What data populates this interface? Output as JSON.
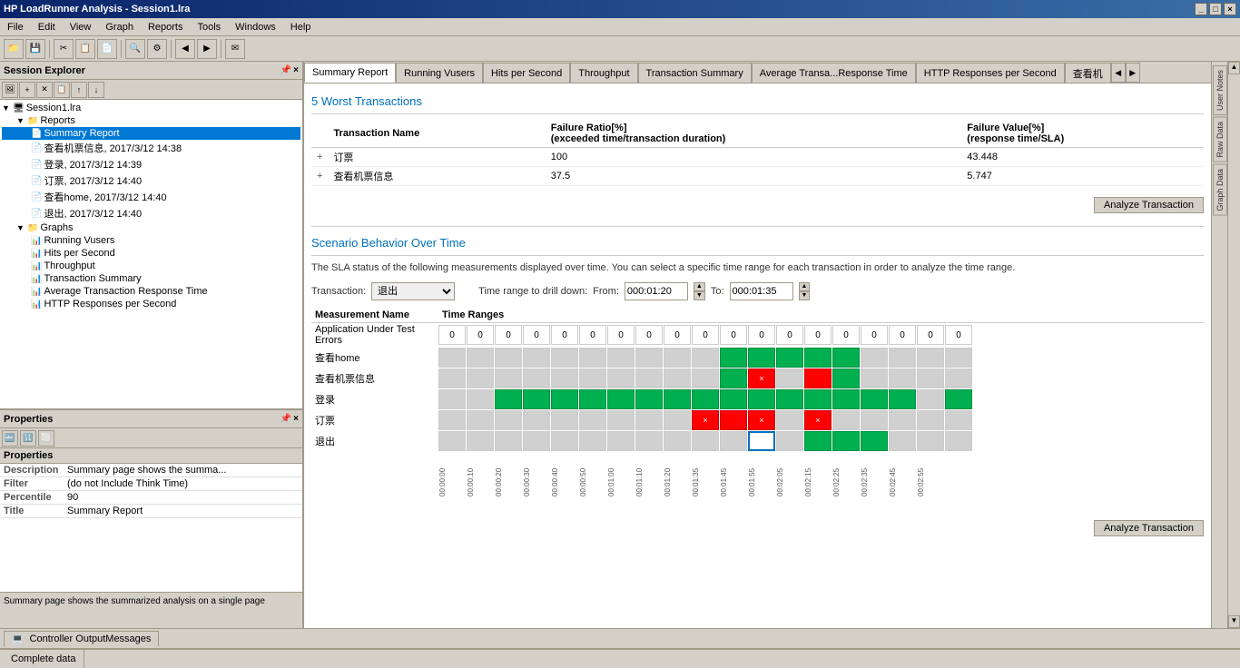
{
  "titleBar": {
    "title": "HP LoadRunner Analysis - Session1.lra",
    "buttons": [
      "_",
      "□",
      "×"
    ]
  },
  "menuBar": {
    "items": [
      "File",
      "Edit",
      "View",
      "Graph",
      "Reports",
      "Tools",
      "Windows",
      "Help"
    ]
  },
  "sessionExplorer": {
    "title": "Session Explorer",
    "tree": {
      "root": "Session1.lra",
      "reports": {
        "label": "Reports",
        "children": [
          {
            "label": "Summary Report",
            "selected": true
          },
          {
            "label": "查看机票信息, 2017/3/12 14:38"
          },
          {
            "label": "登录, 2017/3/12 14:39"
          },
          {
            "label": "订票, 2017/3/12 14:40"
          },
          {
            "label": "查看home, 2017/3/12 14:40"
          },
          {
            "label": "退出, 2017/3/12 14:40"
          }
        ]
      },
      "graphs": {
        "label": "Graphs",
        "children": [
          {
            "label": "Running Vusers"
          },
          {
            "label": "Hits per Second"
          },
          {
            "label": "Throughput"
          },
          {
            "label": "Transaction Summary"
          },
          {
            "label": "Average Transaction Response Time"
          },
          {
            "label": "HTTP Responses per Second"
          }
        ]
      }
    }
  },
  "properties": {
    "title": "Properties",
    "rows": [
      {
        "key": "Description",
        "value": "Summary page shows the summa..."
      },
      {
        "key": "Filter",
        "value": "(do not Include Think Time)"
      },
      {
        "key": "Percentile",
        "value": "90"
      },
      {
        "key": "Title",
        "value": "Summary Report"
      }
    ]
  },
  "statusBarLeft": "Summary page shows the summarized analysis on a single page",
  "tabs": [
    {
      "label": "Summary Report",
      "active": true
    },
    {
      "label": "Running Vusers"
    },
    {
      "label": "Hits per Second"
    },
    {
      "label": "Throughput"
    },
    {
      "label": "Transaction Summary"
    },
    {
      "label": "Average Transa...Response Time"
    },
    {
      "label": "HTTP Responses per Second"
    },
    {
      "label": "查看机"
    }
  ],
  "rightSidebar": {
    "items": [
      "User Notes",
      "Raw Data",
      "Graph Data"
    ]
  },
  "mainContent": {
    "worstTransactions": {
      "title": "5 Worst Transactions",
      "tableHeaders": [
        "Transaction Name",
        "Failure Ratio[%]\n(exceeded time/transaction duration)",
        "Failure Value[%]\n(response time/SLA)"
      ],
      "rows": [
        {
          "expand": "+",
          "name": "订票",
          "failureRatio": "100",
          "failureValue": "43.448"
        },
        {
          "expand": "+",
          "name": "查看机票信息",
          "failureRatio": "37.5",
          "failureValue": "5.747"
        }
      ],
      "analyzeBtn": "Analyze Transaction"
    },
    "scenarioBehavior": {
      "title": "Scenario Behavior Over Time",
      "description": "The SLA status of the following measurements displayed over time. You can select a specific time range for each transaction in order to analyze the time range.",
      "transactionLabel": "Transaction:",
      "transactionValue": "退出",
      "drillDownLabel": "Time range to drill down:",
      "fromLabel": "From:",
      "fromValue": "000:01:20",
      "toLabel": "To:",
      "toValue": "000:01:35",
      "gridHeaders": [
        "Measurement Name",
        "Time Ranges"
      ],
      "gridRows": [
        {
          "label": "Application Under Test Errors",
          "cells": [
            {
              "type": "num",
              "val": "0"
            },
            {
              "type": "num",
              "val": "0"
            },
            {
              "type": "num",
              "val": "0"
            },
            {
              "type": "num",
              "val": "0"
            },
            {
              "type": "num",
              "val": "0"
            },
            {
              "type": "num",
              "val": "0"
            },
            {
              "type": "num",
              "val": "0"
            },
            {
              "type": "num",
              "val": "0"
            },
            {
              "type": "num",
              "val": "0"
            },
            {
              "type": "num",
              "val": "0"
            },
            {
              "type": "num",
              "val": "0"
            },
            {
              "type": "num",
              "val": "0"
            },
            {
              "type": "num",
              "val": "0"
            },
            {
              "type": "num",
              "val": "0"
            },
            {
              "type": "num",
              "val": "0"
            },
            {
              "type": "num",
              "val": "0"
            },
            {
              "type": "num",
              "val": "0"
            },
            {
              "type": "num",
              "val": "0"
            },
            {
              "type": "num",
              "val": "0"
            }
          ]
        },
        {
          "label": "查看home",
          "cells": [
            {
              "type": "gray"
            },
            {
              "type": "gray"
            },
            {
              "type": "gray"
            },
            {
              "type": "gray"
            },
            {
              "type": "gray"
            },
            {
              "type": "gray"
            },
            {
              "type": "gray"
            },
            {
              "type": "gray"
            },
            {
              "type": "gray"
            },
            {
              "type": "gray"
            },
            {
              "type": "green"
            },
            {
              "type": "green"
            },
            {
              "type": "green"
            },
            {
              "type": "green"
            },
            {
              "type": "green"
            },
            {
              "type": "gray"
            },
            {
              "type": "gray"
            },
            {
              "type": "gray"
            },
            {
              "type": "gray"
            }
          ]
        },
        {
          "label": "查看机票信息",
          "cells": [
            {
              "type": "gray"
            },
            {
              "type": "gray"
            },
            {
              "type": "gray"
            },
            {
              "type": "gray"
            },
            {
              "type": "gray"
            },
            {
              "type": "gray"
            },
            {
              "type": "gray"
            },
            {
              "type": "gray"
            },
            {
              "type": "gray"
            },
            {
              "type": "gray"
            },
            {
              "type": "green"
            },
            {
              "type": "red-x"
            },
            {
              "type": "gray"
            },
            {
              "type": "red"
            },
            {
              "type": "green"
            },
            {
              "type": "gray"
            },
            {
              "type": "gray"
            },
            {
              "type": "gray"
            },
            {
              "type": "gray"
            }
          ]
        },
        {
          "label": "登录",
          "cells": [
            {
              "type": "gray"
            },
            {
              "type": "gray"
            },
            {
              "type": "green"
            },
            {
              "type": "green"
            },
            {
              "type": "green"
            },
            {
              "type": "green"
            },
            {
              "type": "green"
            },
            {
              "type": "green"
            },
            {
              "type": "green"
            },
            {
              "type": "green"
            },
            {
              "type": "green"
            },
            {
              "type": "green"
            },
            {
              "type": "green"
            },
            {
              "type": "green"
            },
            {
              "type": "green"
            },
            {
              "type": "green"
            },
            {
              "type": "green"
            },
            {
              "type": "gray"
            },
            {
              "type": "green"
            }
          ]
        },
        {
          "label": "订票",
          "cells": [
            {
              "type": "gray"
            },
            {
              "type": "gray"
            },
            {
              "type": "gray"
            },
            {
              "type": "gray"
            },
            {
              "type": "gray"
            },
            {
              "type": "gray"
            },
            {
              "type": "gray"
            },
            {
              "type": "gray"
            },
            {
              "type": "gray"
            },
            {
              "type": "red-x"
            },
            {
              "type": "red"
            },
            {
              "type": "red-x"
            },
            {
              "type": "gray"
            },
            {
              "type": "red-x"
            },
            {
              "type": "gray"
            },
            {
              "type": "gray"
            },
            {
              "type": "gray"
            },
            {
              "type": "gray"
            },
            {
              "type": "gray"
            }
          ]
        },
        {
          "label": "退出",
          "cells": [
            {
              "type": "gray"
            },
            {
              "type": "gray"
            },
            {
              "type": "gray"
            },
            {
              "type": "gray"
            },
            {
              "type": "gray"
            },
            {
              "type": "gray"
            },
            {
              "type": "gray"
            },
            {
              "type": "gray"
            },
            {
              "type": "gray"
            },
            {
              "type": "gray"
            },
            {
              "type": "gray"
            },
            {
              "type": "selected-blue"
            },
            {
              "type": "gray"
            },
            {
              "type": "green"
            },
            {
              "type": "green"
            },
            {
              "type": "green"
            },
            {
              "type": "gray"
            },
            {
              "type": "gray"
            },
            {
              "type": "gray"
            }
          ]
        }
      ],
      "timeLabels": [
        "00:00:00",
        "00:00:10",
        "00:00:20",
        "00:00:30",
        "00:00:40",
        "00:00:50",
        "00:01:00",
        "00:01:10",
        "00:01:20",
        "00:01:35",
        "00:01:45",
        "00:01:55",
        "00:02:05",
        "00:02:15",
        "00:02:25",
        "00:02:35",
        "00:02:45",
        "00:02:55"
      ],
      "analyzeBtn2": "Analyze Transaction"
    }
  },
  "statusBar": {
    "segment1": "Complete data"
  },
  "bottomPanel": {
    "tabLabel": "Controller OutputMessages"
  }
}
